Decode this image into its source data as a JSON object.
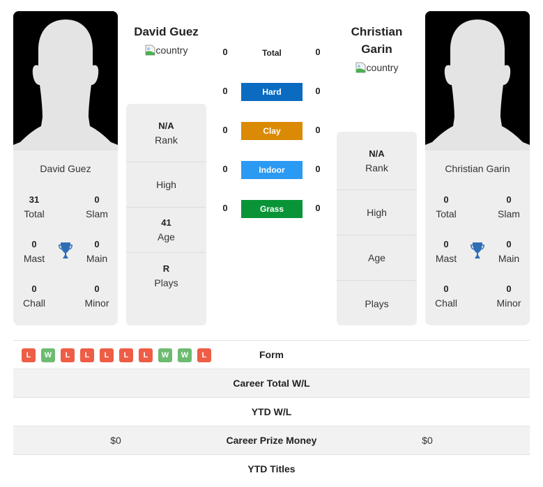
{
  "players": {
    "left": {
      "name": "David Guez",
      "flag_alt": "country",
      "card_name": "David Guez",
      "titles": {
        "total": {
          "value": "31",
          "label": "Total"
        },
        "slam": {
          "value": "0",
          "label": "Slam"
        },
        "mast": {
          "value": "0",
          "label": "Mast"
        },
        "main": {
          "value": "0",
          "label": "Main"
        },
        "chall": {
          "value": "0",
          "label": "Chall"
        },
        "minor": {
          "value": "0",
          "label": "Minor"
        }
      },
      "info": {
        "rank": {
          "value": "N/A",
          "label": "Rank"
        },
        "high": {
          "value": "",
          "label": "High"
        },
        "age": {
          "value": "41",
          "label": "Age"
        },
        "plays": {
          "value": "R",
          "label": "Plays"
        }
      }
    },
    "right": {
      "name": "Christian Garin",
      "flag_alt": "country",
      "card_name": "Christian Garin",
      "titles": {
        "total": {
          "value": "0",
          "label": "Total"
        },
        "slam": {
          "value": "0",
          "label": "Slam"
        },
        "mast": {
          "value": "0",
          "label": "Mast"
        },
        "main": {
          "value": "0",
          "label": "Main"
        },
        "chall": {
          "value": "0",
          "label": "Chall"
        },
        "minor": {
          "value": "0",
          "label": "Minor"
        }
      },
      "info": {
        "rank": {
          "value": "N/A",
          "label": "Rank"
        },
        "high": {
          "value": "",
          "label": "High"
        },
        "age": {
          "value": "",
          "label": "Age"
        },
        "plays": {
          "value": "",
          "label": "Plays"
        }
      }
    }
  },
  "h2h": {
    "total": {
      "label": "Total",
      "left": "0",
      "right": "0"
    },
    "hard": {
      "label": "Hard",
      "left": "0",
      "right": "0",
      "color": "#0a6bc1"
    },
    "clay": {
      "label": "Clay",
      "left": "0",
      "right": "0",
      "color": "#db8a05"
    },
    "indoor": {
      "label": "Indoor",
      "left": "0",
      "right": "0",
      "color": "#2b9af3"
    },
    "grass": {
      "label": "Grass",
      "left": "0",
      "right": "0",
      "color": "#0a9438"
    }
  },
  "comparison": {
    "form": {
      "label": "Form",
      "left_results": [
        "L",
        "W",
        "L",
        "L",
        "L",
        "L",
        "L",
        "W",
        "W",
        "L"
      ]
    },
    "career_total_wl": {
      "label": "Career Total W/L",
      "left": "",
      "right": ""
    },
    "ytd_wl": {
      "label": "YTD W/L",
      "left": "",
      "right": ""
    },
    "career_prize_money": {
      "label": "Career Prize Money",
      "left": "$0",
      "right": "$0"
    },
    "ytd_titles": {
      "label": "YTD Titles",
      "left": "",
      "right": ""
    }
  },
  "colors": {
    "loss": "#ee5d45",
    "win": "#6dbb70",
    "trophy": "#2f6db5"
  }
}
